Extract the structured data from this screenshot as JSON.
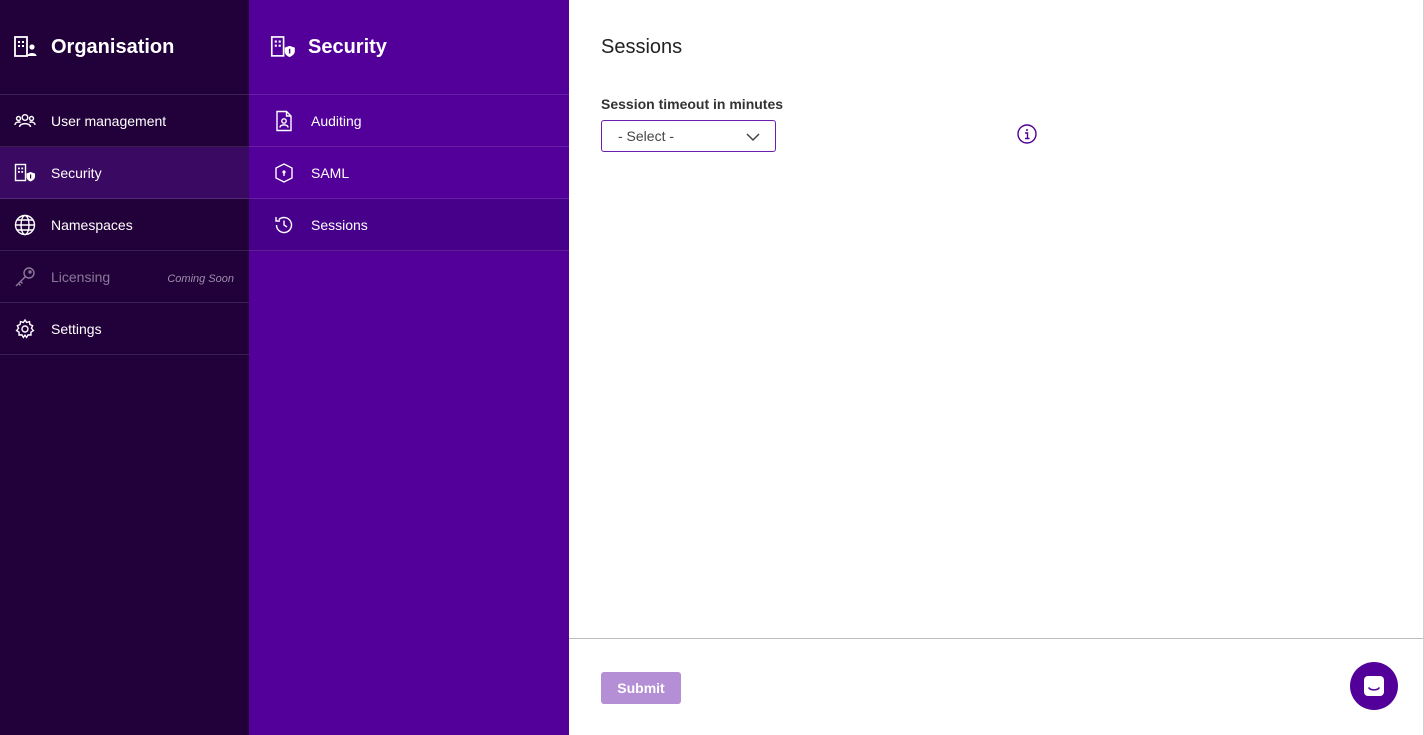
{
  "primary_sidebar": {
    "title": "Organisation",
    "title_icon": "organisation-icon",
    "items": [
      {
        "label": "User management",
        "icon": "users-icon"
      },
      {
        "label": "Security",
        "icon": "security-building-icon",
        "active": true
      },
      {
        "label": "Namespaces",
        "icon": "globe-icon"
      },
      {
        "label": "Licensing",
        "icon": "key-icon",
        "disabled": true,
        "badge": "Coming Soon"
      },
      {
        "label": "Settings",
        "icon": "gear-icon"
      }
    ]
  },
  "secondary_sidebar": {
    "title": "Security",
    "title_icon": "security-building-icon",
    "items": [
      {
        "label": "Auditing",
        "icon": "audit-document-icon"
      },
      {
        "label": "SAML",
        "icon": "shield-icon"
      },
      {
        "label": "Sessions",
        "icon": "history-icon",
        "active": true
      }
    ]
  },
  "main": {
    "title": "Sessions",
    "field_label": "Session timeout in minutes",
    "select_value": "- Select -",
    "submit_label": "Submit"
  },
  "colors": {
    "primary_sidebar_bg": "#22003a",
    "secondary_sidebar_bg": "#520099",
    "accent": "#6a1fb0",
    "submit_disabled": "#b48fd6"
  }
}
